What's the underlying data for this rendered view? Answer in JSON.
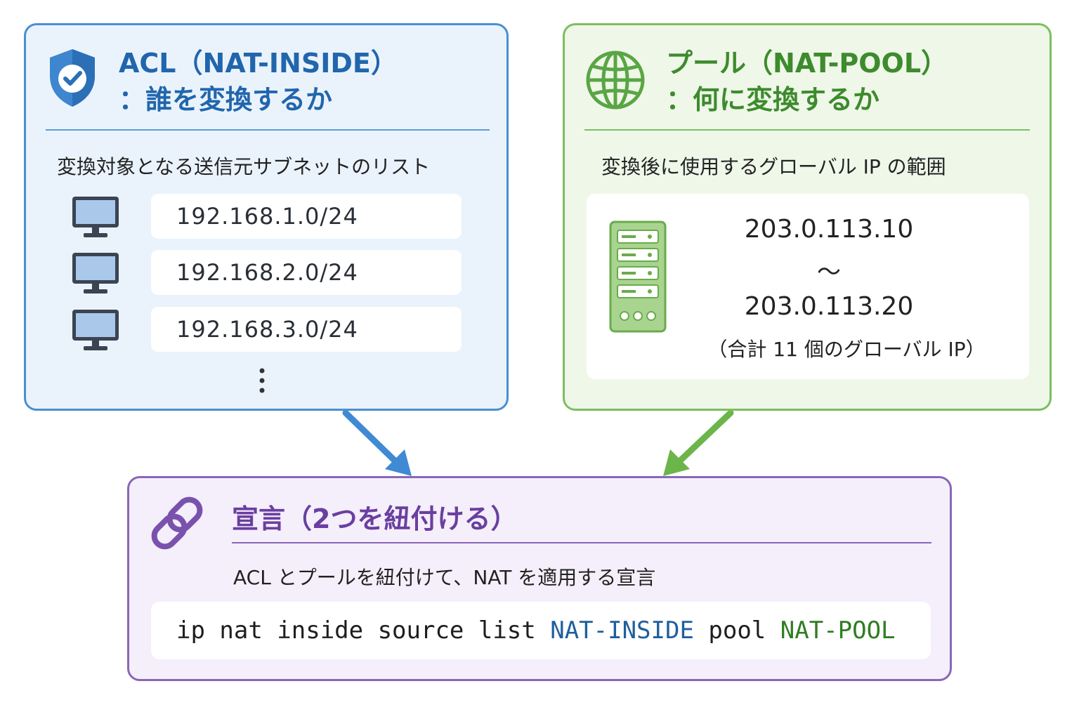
{
  "acl": {
    "title_line1": "ACL（NAT-INSIDE）",
    "title_line2": "：誰を変換するか",
    "subtitle": "変換対象となる送信元サブネットのリスト",
    "subnets": [
      "192.168.1.0/24",
      "192.168.2.0/24",
      "192.168.3.0/24"
    ],
    "more_indicator": "⋮",
    "icons": [
      "shield-check-icon",
      "computer-icon"
    ],
    "color": "#2166ac"
  },
  "pool": {
    "title_line1": "プール（NAT-POOL）",
    "title_line2": "：何に変換するか",
    "subtitle": "変換後に使用するグローバル IP の範囲",
    "range_start": "203.0.113.10",
    "range_separator": "〜",
    "range_end": "203.0.113.20",
    "note": "（合計 11 個のグローバル IP）",
    "icons": [
      "globe-icon",
      "server-icon"
    ],
    "color": "#3d8b2d"
  },
  "declaration": {
    "title": "宣言（2つを紐付ける）",
    "subtitle": "ACL とプールを紐付けて、NAT を適用する宣言",
    "command": {
      "prefix": "ip nat inside source list ",
      "acl_name": "NAT-INSIDE",
      "middle": " pool ",
      "pool_name": "NAT-POOL"
    },
    "icons": [
      "link-icon"
    ],
    "color": "#6a3fa0"
  }
}
